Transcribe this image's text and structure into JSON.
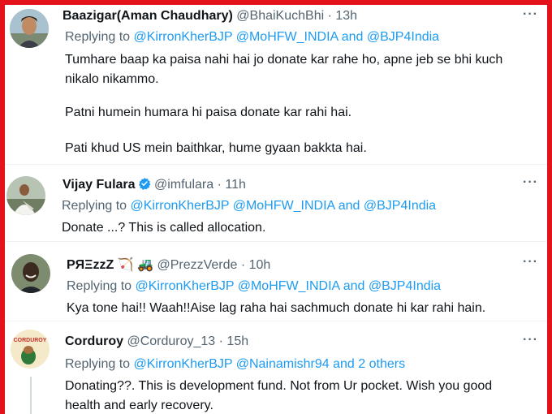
{
  "colors": {
    "frame_border": "#e4121b",
    "link": "#1d9bf0",
    "muted": "#536471",
    "text": "#0f1419",
    "verified": "#1d9bf0"
  },
  "tweets": [
    {
      "name": "Baazigar(Aman Chaudhary)",
      "handle": "@BhaiKuchBhi",
      "time": "· 13h",
      "more_icon": "···",
      "reply_prefix": "Replying to",
      "reply_to": "@KirronKherBJP @MoHFW_INDIA and @BJP4India",
      "lines": [
        "Tumhare baap ka paisa nahi hai jo donate kar rahe ho, apne jeb se bhi kuch",
        "nikalo nikammo.",
        "Patni humein humara hi paisa donate kar rahi hai.",
        "Pati khud US mein baithkar, hume gyaan bakkta hai."
      ]
    },
    {
      "name": "Vijay Fulara",
      "verified_icon": "verified-badge",
      "handle": "@imfulara",
      "time": "· 11h",
      "more_icon": "···",
      "reply_prefix": "Replying to",
      "reply_to": "@KirronKherBJP @MoHFW_INDIA and @BJP4India",
      "lines": [
        "Donate ...? This is called allocation."
      ]
    },
    {
      "name": "PЯΞzzZ",
      "name_emoji": "🏹 🚜",
      "handle": "@PrezzVerde",
      "time": "· 10h",
      "more_icon": "···",
      "reply_prefix": "Replying to",
      "reply_to": "@KirronKherBJP @MoHFW_INDIA and @BJP4India",
      "lines": [
        "Kya tone hai!! Waah!!Aise lag raha hai sachmuch donate hi kar rahi hain."
      ]
    },
    {
      "name": "Corduroy",
      "avatar_text": "CORDUROY",
      "handle": "@Corduroy_13",
      "time": "· 15h",
      "more_icon": "···",
      "reply_prefix": "Replying to",
      "reply_to": "@KirronKherBJP @Nainamishr94 and 2 others",
      "lines": [
        "Donating??. This is development fund. Not from Ur pocket. Wish you good",
        "health and early recovery."
      ]
    }
  ]
}
